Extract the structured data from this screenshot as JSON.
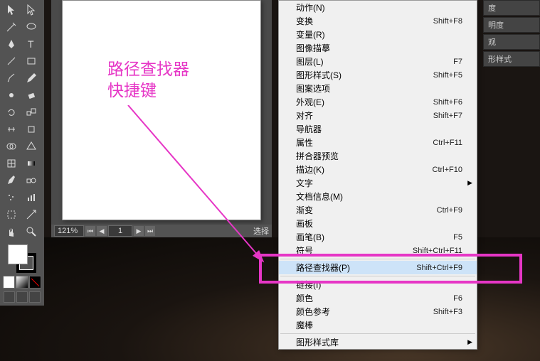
{
  "zoom": "121%",
  "page_current": "1",
  "select_label": "选择",
  "annotation": {
    "line1": "路径查找器",
    "line2": "快捷键"
  },
  "panels": {
    "p1": "度",
    "p2": "明度",
    "p3": "观",
    "p4": "形样式"
  },
  "menu": {
    "items": [
      {
        "label": "动作(N)",
        "shortcut": ""
      },
      {
        "label": "变换",
        "shortcut": "Shift+F8"
      },
      {
        "label": "变量(R)",
        "shortcut": ""
      },
      {
        "label": "图像描摹",
        "shortcut": ""
      },
      {
        "label": "图层(L)",
        "shortcut": "F7"
      },
      {
        "label": "图形样式(S)",
        "shortcut": "Shift+F5"
      },
      {
        "label": "图案选项",
        "shortcut": ""
      },
      {
        "label": "外观(E)",
        "shortcut": "Shift+F6"
      },
      {
        "label": "对齐",
        "shortcut": "Shift+F7"
      },
      {
        "label": "导航器",
        "shortcut": ""
      },
      {
        "label": "属性",
        "shortcut": "Ctrl+F11"
      },
      {
        "label": "拼合器预览",
        "shortcut": ""
      },
      {
        "label": "描边(K)",
        "shortcut": "Ctrl+F10"
      },
      {
        "label": "文字",
        "shortcut": "",
        "sub": true
      },
      {
        "label": "文档信息(M)",
        "shortcut": ""
      },
      {
        "label": "渐变",
        "shortcut": "Ctrl+F9"
      },
      {
        "label": "画板",
        "shortcut": ""
      },
      {
        "label": "画笔(B)",
        "shortcut": "F5"
      },
      {
        "label": "符号",
        "shortcut": "Shift+Ctrl+F11"
      },
      {
        "sep": true
      },
      {
        "label": "路径查找器(P)",
        "shortcut": "Shift+Ctrl+F9",
        "hl": true
      },
      {
        "sep": true
      },
      {
        "label": "链接(I)",
        "shortcut": ""
      },
      {
        "label": "颜色",
        "shortcut": "F6"
      },
      {
        "label": "颜色参考",
        "shortcut": "Shift+F3"
      },
      {
        "label": "魔棒",
        "shortcut": ""
      },
      {
        "sep": true
      },
      {
        "label": "图形样式库",
        "shortcut": "",
        "sub": true
      }
    ]
  }
}
